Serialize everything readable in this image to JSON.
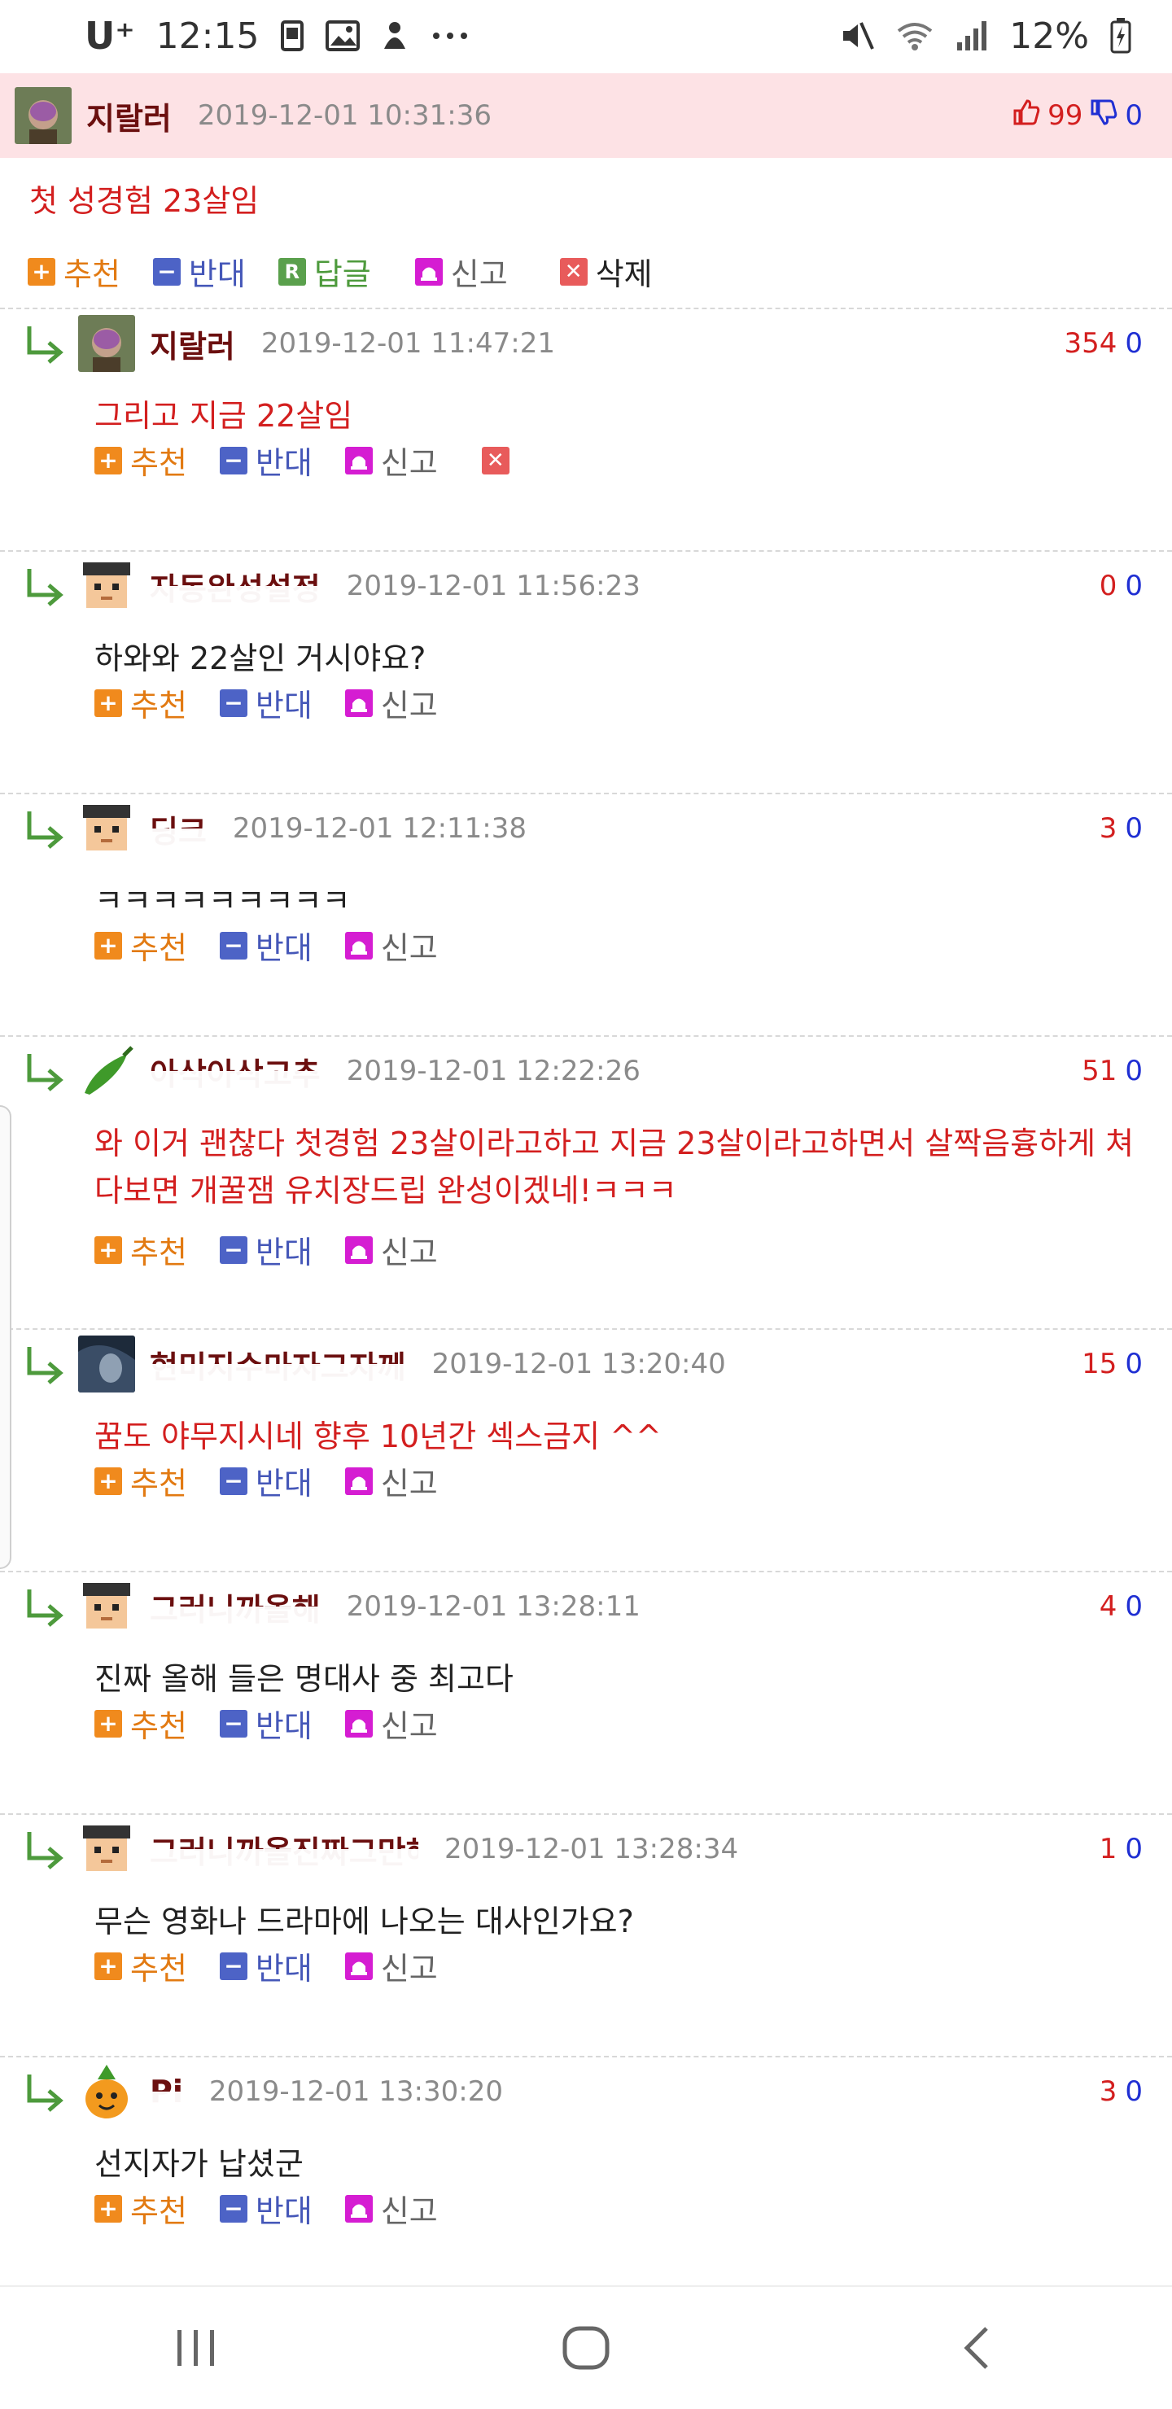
{
  "status": {
    "carrier": "U⁺",
    "time": "12:15",
    "battery": "12%",
    "icons": [
      "gallery-icon",
      "image-icon",
      "bixby-icon",
      "more-icon",
      "mute-icon",
      "wifi-icon",
      "signal-icon",
      "battery-icon"
    ]
  },
  "post": {
    "author": "지랄러",
    "timestamp": "2019-12-01 10:31:36",
    "up": "99",
    "down": "0",
    "body": "첫 성경험 23살임",
    "actions": {
      "recommend": "추천",
      "oppose": "반대",
      "reply": "답글",
      "report": "신고",
      "delete": "삭제"
    }
  },
  "comment_actions": {
    "recommend": "추천",
    "oppose": "반대",
    "report": "신고"
  },
  "comments": [
    {
      "author": "지랄러",
      "timestamp": "2019-12-01 11:47:21",
      "up": "354",
      "down": "0",
      "text": "그리고 지금 22살임",
      "red": true,
      "avatar": "mask"
    },
    {
      "author": "자동완성설정",
      "timestamp": "2019-12-01 11:56:23",
      "up": "0",
      "down": "0",
      "text": "하와와 22살인 거시야요?",
      "red": false,
      "avatar": "pixel"
    },
    {
      "author": "딩크",
      "timestamp": "2019-12-01 12:11:38",
      "up": "3",
      "down": "0",
      "text": "ㅋㅋㅋㅋㅋㅋㅋㅋㅋ",
      "red": false,
      "avatar": "pixel"
    },
    {
      "author": "아삭아삭고추",
      "timestamp": "2019-12-01 12:22:26",
      "up": "51",
      "down": "0",
      "text": "와 이거 괜찮다 첫경험 23살이라고하고 지금 23살이라고하면서 살짝음흉하게 쳐다보면 개꿀잼 유치장드립 완성이겠네!ㅋㅋㅋ",
      "red": true,
      "avatar": "pepper"
    },
    {
      "author": "현미지수마자그자께",
      "timestamp": "2019-12-01 13:20:40",
      "up": "15",
      "down": "0",
      "text": "꿈도 야무지시네 향후 10년간 섹스금지 ^^",
      "red": true,
      "avatar": "photo"
    },
    {
      "author": "그러니까올해",
      "timestamp": "2019-12-01 13:28:11",
      "up": "4",
      "down": "0",
      "text": "진짜 올해 들은 명대사 중 최고다",
      "red": false,
      "avatar": "pixel"
    },
    {
      "author": "그러니까올진짜그만해",
      "timestamp": "2019-12-01 13:28:34",
      "up": "1",
      "down": "0",
      "text": "무슨 영화나 드라마에 나오는 대사인가요?",
      "red": false,
      "avatar": "pixel"
    },
    {
      "author": "Pi",
      "timestamp": "2019-12-01 13:30:20",
      "up": "3",
      "down": "0",
      "text": "선지자가 납셨군",
      "red": false,
      "avatar": "pineapple"
    }
  ],
  "colors": {
    "post_bg": "#fde2e5",
    "red": "#d31f1f",
    "blue": "#1f2fd3",
    "recommend": "#f08a1d",
    "oppose": "#4d63c6"
  },
  "nav": [
    "recent-apps-icon",
    "home-icon",
    "back-icon"
  ]
}
